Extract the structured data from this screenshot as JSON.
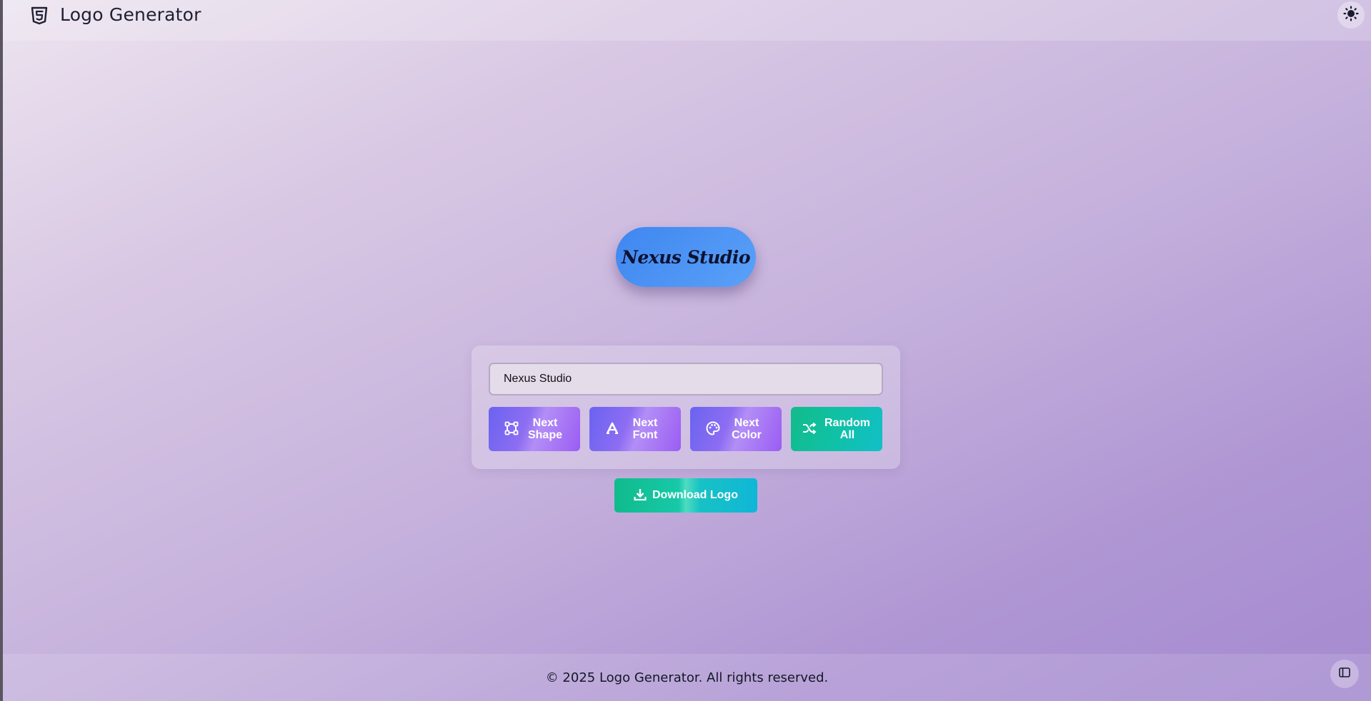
{
  "header": {
    "title": "Logo Generator",
    "brand_icon": "html5-shield-icon",
    "theme_toggle_icon": "sun-icon"
  },
  "preview": {
    "logo_text": "Nexus Studio",
    "shape": "pill",
    "fill_color": "#4a90f2",
    "text_color": "#0d1230"
  },
  "controls": {
    "name_input_value": "Nexus Studio",
    "buttons": [
      {
        "label_line1": "Next",
        "label_line2": "Shape",
        "icon": "vector-square-icon"
      },
      {
        "label_line1": "Next",
        "label_line2": "Font",
        "icon": "font-icon"
      },
      {
        "label_line1": "Next",
        "label_line2": "Color",
        "icon": "palette-icon"
      },
      {
        "label_line1": "Random",
        "label_line2": "All",
        "icon": "shuffle-icon"
      }
    ],
    "download_label": "Download Logo",
    "download_icon": "download-icon"
  },
  "footer": {
    "text": "© 2025 Logo Generator. All rights reserved.",
    "sidebar_icon": "sidebar-panel-icon"
  },
  "colors": {
    "accent_purple": "#7c6cf2",
    "accent_teal": "#12c0a8",
    "logo_blue": "#4a90f2"
  }
}
